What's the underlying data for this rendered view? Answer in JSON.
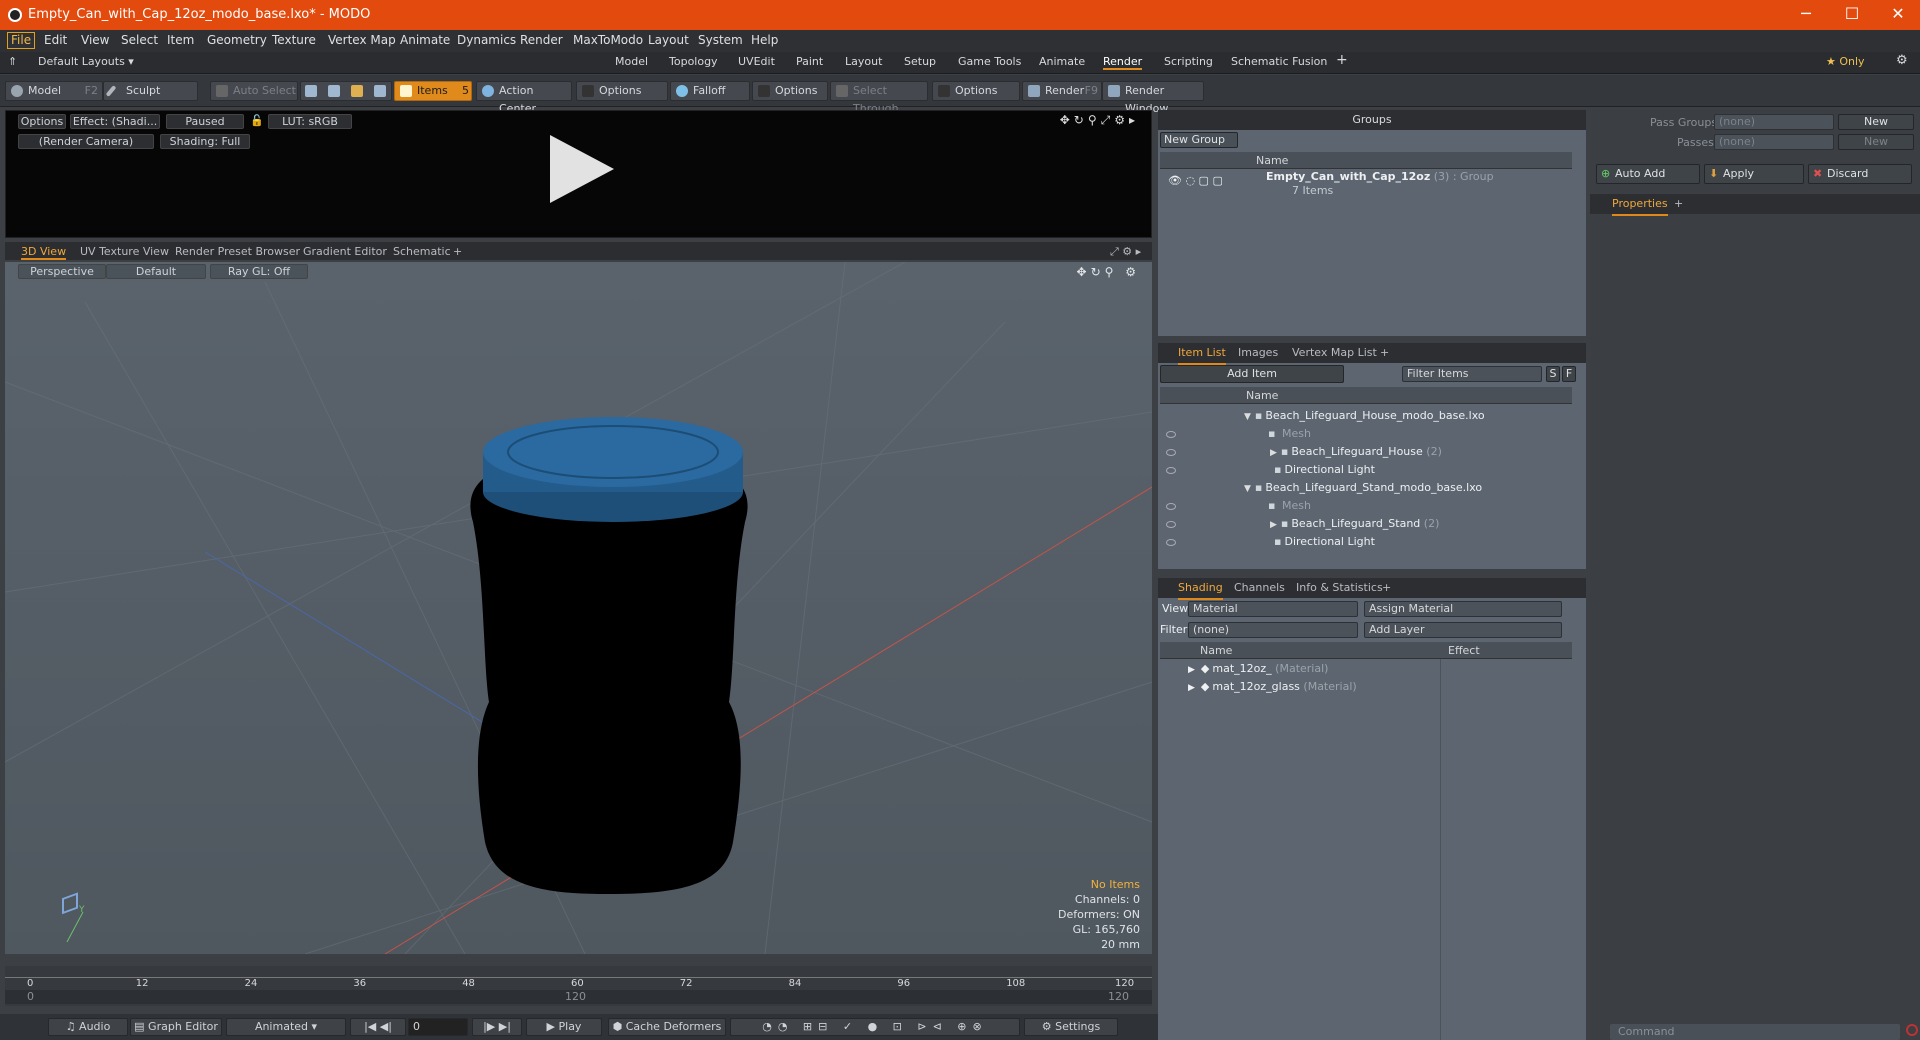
{
  "window": {
    "title": "Empty_Can_with_Cap_12oz_modo_base.lxo* - MODO",
    "controls": {
      "min": "─",
      "max": "☐",
      "close": "✕"
    }
  },
  "menu": [
    "File",
    "Edit",
    "View",
    "Select",
    "Item",
    "Geometry",
    "Texture",
    "Vertex Map",
    "Animate",
    "Dynamics",
    "Render",
    "MaxToModo",
    "Layout",
    "System",
    "Help"
  ],
  "layout": {
    "default_layouts": "Default Layouts ▾",
    "tabs": [
      "Model",
      "Topology",
      "UVEdit",
      "Paint",
      "Layout",
      "Setup",
      "Game Tools",
      "Animate",
      "Render",
      "Scripting",
      "Schematic Fusion",
      "+"
    ],
    "active_tab": "Render",
    "only": "★ Only"
  },
  "toolbar": {
    "model": "Model",
    "model_key": "F2",
    "sculpt": "Sculpt",
    "auto_select": "Auto Select",
    "items": "Items",
    "items_key": "5",
    "action_center": "Action Center",
    "options1": "Options",
    "falloff": "Falloff",
    "options2": "Options",
    "select_through": "Select Through",
    "options3": "Options",
    "render": "Render",
    "render_key": "F9",
    "render_window": "Render Window"
  },
  "render_preview": {
    "options": "Options",
    "effect": "Effect: (Shadi...",
    "paused": "Paused",
    "lut": "LUT: sRGB",
    "camera": "(Render Camera)",
    "shading": "Shading: Full"
  },
  "view_tabs": [
    "3D View",
    "UV Texture View",
    "Render Preset Browser",
    "Gradient Editor",
    "Schematic",
    "+"
  ],
  "viewport": {
    "projection": "Perspective",
    "style": "Default",
    "raygl": "Ray GL: Off",
    "info": [
      "No Items",
      "Channels: 0",
      "Deformers: ON",
      "GL: 165,760",
      "20 mm"
    ]
  },
  "timeline": {
    "ticks": [
      "0",
      "12",
      "24",
      "36",
      "48",
      "60",
      "72",
      "84",
      "96",
      "108",
      "120"
    ],
    "sub_ticks": [
      "0",
      "120",
      "120"
    ]
  },
  "bottom": {
    "audio": "Audio",
    "graph_editor": "Graph Editor",
    "animated": "Animated",
    "frame": "0",
    "play": "Play",
    "cache": "Cache Deformers",
    "settings": "Settings"
  },
  "groups": {
    "title": "Groups",
    "new_group": "New Group",
    "col_name": "Name",
    "item_name": "Empty_Can_with_Cap_12oz",
    "item_count": "(3)",
    "item_type": ": Group",
    "item_sub": "7 Items"
  },
  "itemlist": {
    "tabs": [
      "Item List",
      "Images",
      "Vertex Map List",
      "+"
    ],
    "add_item": "Add Item",
    "filter": "Filter Items",
    "s": "S",
    "f": "F",
    "col_name": "Name",
    "rows": [
      {
        "label": "Beach_Lifeguard_House_modo_base.lxo",
        "gray": ""
      },
      {
        "label": "",
        "gray": "Mesh"
      },
      {
        "label": "Beach_Lifeguard_House",
        "gray": "(2)"
      },
      {
        "label": "Directional Light",
        "gray": ""
      },
      {
        "label": "Beach_Lifeguard_Stand_modo_base.lxo",
        "gray": ""
      },
      {
        "label": "",
        "gray": "Mesh"
      },
      {
        "label": "Beach_Lifeguard_Stand",
        "gray": "(2)"
      },
      {
        "label": "Directional Light",
        "gray": ""
      }
    ]
  },
  "shading": {
    "tabs": [
      "Shading",
      "Channels",
      "Info & Statistics",
      "+"
    ],
    "view_label": "View",
    "view_value": "Material",
    "assign": "Assign Material",
    "filter_label": "Filter",
    "filter_value": "(none)",
    "add_layer": "Add Layer",
    "col_name": "Name",
    "col_effect": "Effect",
    "rows": [
      {
        "label": "mat_12oz_",
        "gray": "(Material)"
      },
      {
        "label": "mat_12oz_glass",
        "gray": "(Material)"
      }
    ]
  },
  "right": {
    "pass_groups": "Pass Groups",
    "passes": "Passes",
    "none": "(none)",
    "new": "New",
    "auto_add": "Auto Add",
    "apply": "Apply",
    "discard": "Discard",
    "properties": "Properties",
    "command": "Command"
  }
}
